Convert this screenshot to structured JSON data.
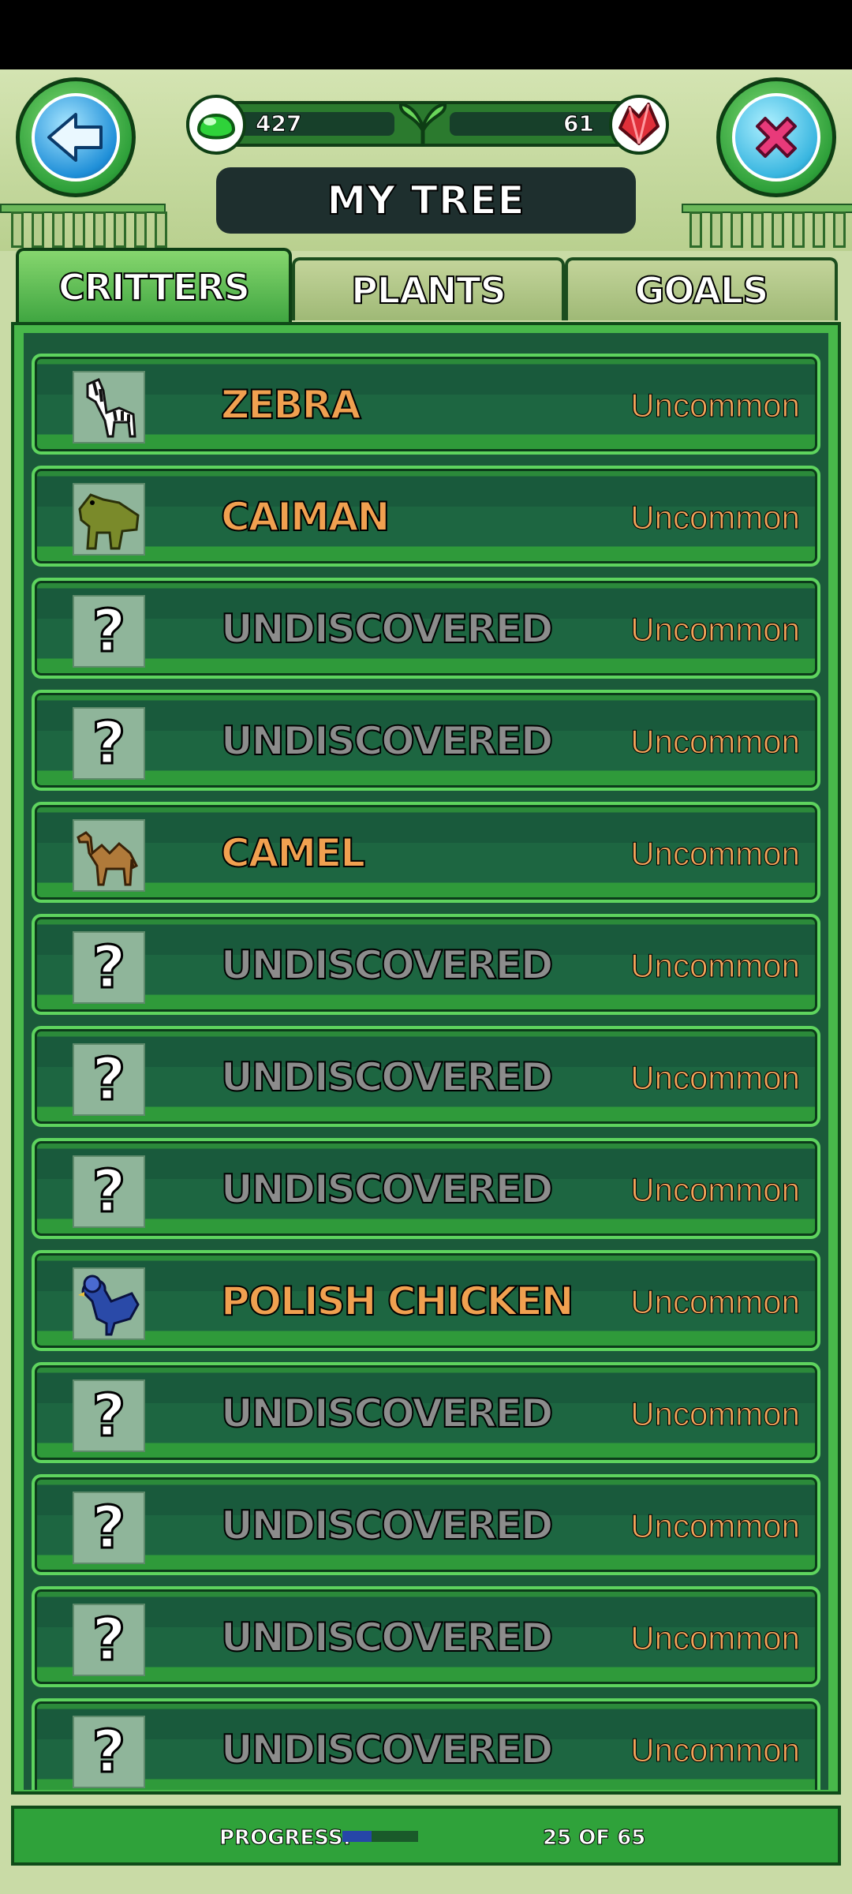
{
  "header": {
    "title": "MY TREE",
    "back_icon": "back-arrow-icon",
    "close_icon": "close-x-icon",
    "green_currency": "427",
    "gem_currency": "61"
  },
  "tabs": [
    {
      "label": "CRITTERS",
      "active": true
    },
    {
      "label": "PLANTS",
      "active": false
    },
    {
      "label": "GOALS",
      "active": false
    }
  ],
  "critters": [
    {
      "name": "ZEBRA",
      "rarity": "Uncommon",
      "discovered": true,
      "icon": "zebra-icon"
    },
    {
      "name": "CAIMAN",
      "rarity": "Uncommon",
      "discovered": true,
      "icon": "caiman-icon"
    },
    {
      "name": "UNDISCOVERED",
      "rarity": "Uncommon",
      "discovered": false,
      "icon": "question-mark-icon"
    },
    {
      "name": "UNDISCOVERED",
      "rarity": "Uncommon",
      "discovered": false,
      "icon": "question-mark-icon"
    },
    {
      "name": "CAMEL",
      "rarity": "Uncommon",
      "discovered": true,
      "icon": "camel-icon"
    },
    {
      "name": "UNDISCOVERED",
      "rarity": "Uncommon",
      "discovered": false,
      "icon": "question-mark-icon"
    },
    {
      "name": "UNDISCOVERED",
      "rarity": "Uncommon",
      "discovered": false,
      "icon": "question-mark-icon"
    },
    {
      "name": "UNDISCOVERED",
      "rarity": "Uncommon",
      "discovered": false,
      "icon": "question-mark-icon"
    },
    {
      "name": "POLISH CHICKEN",
      "rarity": "Uncommon",
      "discovered": true,
      "icon": "polish-chicken-icon"
    },
    {
      "name": "UNDISCOVERED",
      "rarity": "Uncommon",
      "discovered": false,
      "icon": "question-mark-icon"
    },
    {
      "name": "UNDISCOVERED",
      "rarity": "Uncommon",
      "discovered": false,
      "icon": "question-mark-icon"
    },
    {
      "name": "UNDISCOVERED",
      "rarity": "Uncommon",
      "discovered": false,
      "icon": "question-mark-icon"
    },
    {
      "name": "UNDISCOVERED",
      "rarity": "Uncommon",
      "discovered": false,
      "icon": "question-mark-icon"
    }
  ],
  "footer": {
    "progress_label": "PROGRESS:",
    "progress_text": "25 OF 65",
    "progress_fraction": 0.3846
  },
  "colors": {
    "known_name": "#f0a050",
    "unknown_name": "#8c8c8c",
    "rarity": "#f2a45a",
    "panel_green": "#48b84a",
    "progress_fill": "#2646a8"
  }
}
